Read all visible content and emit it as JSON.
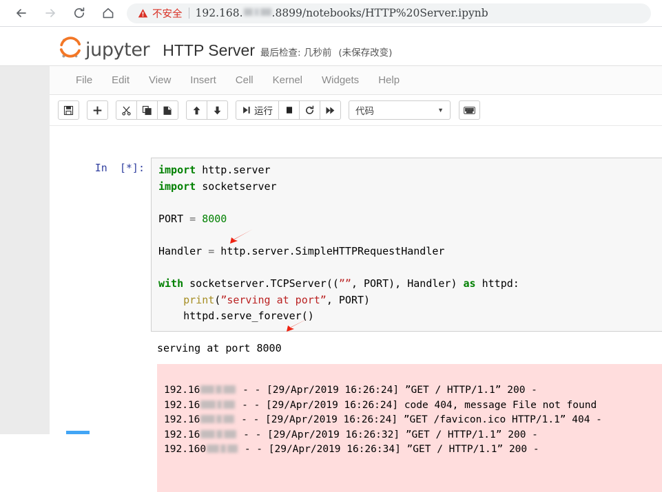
{
  "browser": {
    "back_icon": "arrow-left-icon",
    "forward_icon": "arrow-right-icon",
    "reload_icon": "reload-icon",
    "home_icon": "home-icon",
    "security_icon": "warning-triangle-icon",
    "security_label": "不安全",
    "url_prefix": "192.168.",
    "url_suffix": ".8899/notebooks/HTTP%20Server.ipynb",
    "accent_danger": "#d93025"
  },
  "jupyter": {
    "wordmark": "jupyter",
    "notebook_name": "HTTP Server",
    "checkpoint_text": "最后检查: 几秒前",
    "unsaved_text": "(未保存改变)",
    "logo_color": "#f37726"
  },
  "menubar": {
    "items": [
      {
        "label": "File"
      },
      {
        "label": "Edit"
      },
      {
        "label": "View"
      },
      {
        "label": "Insert"
      },
      {
        "label": "Cell"
      },
      {
        "label": "Kernel"
      },
      {
        "label": "Widgets"
      },
      {
        "label": "Help"
      }
    ]
  },
  "toolbar": {
    "save_icon": "save-floppy-icon",
    "insert_icon": "plus-icon",
    "cut_icon": "scissors-icon",
    "copy_icon": "copy-icon",
    "paste_icon": "paste-icon",
    "move_up_icon": "arrow-up-icon",
    "move_down_icon": "arrow-down-icon",
    "run_icon": "run-step-icon",
    "run_label": "运行",
    "stop_icon": "stop-square-icon",
    "restart_icon": "restart-circle-icon",
    "restart_run_all_icon": "fast-forward-icon",
    "cell_type_value": "代码",
    "cell_type_caret": "chevron-down-icon",
    "keyboard_icon": "keyboard-icon"
  },
  "notebook": {
    "cell": {
      "prompt": "In  [*]:",
      "code_lines": [
        "import http.server",
        "import socketserver",
        "",
        "PORT = 8000",
        "",
        "Handler = http.server.SimpleHTTPRequestHandler",
        "",
        "with socketserver.TCPServer((””, PORT), Handler) as httpd:",
        "    print(”serving at port”, PORT)",
        "    httpd.serve_forever()"
      ],
      "stdout": "serving at port 8000",
      "stderr_lines": [
        {
          "ip_prefix": "192.16",
          "rest": " - - [29/Apr/2019 16:26:24] ”GET / HTTP/1.1” 200 -"
        },
        {
          "ip_prefix": "192.16",
          "rest": " - - [29/Apr/2019 16:26:24] code 404, message File not found"
        },
        {
          "ip_prefix": "192.16",
          "rest": " - - [29/Apr/2019 16:26:24] ”GET /favicon.ico HTTP/1.1” 404 -"
        },
        {
          "ip_prefix": "192.16",
          "rest": " - - [29/Apr/2019 16:26:32] ”GET / HTTP/1.1” 200 -"
        },
        {
          "ip_prefix": "192.160",
          "rest": " - - [29/Apr/2019 16:26:34] ”GET / HTTP/1.1” 200 -"
        }
      ],
      "stderr_background": "#ffdddd"
    },
    "annotation_color": "#ee2211"
  }
}
